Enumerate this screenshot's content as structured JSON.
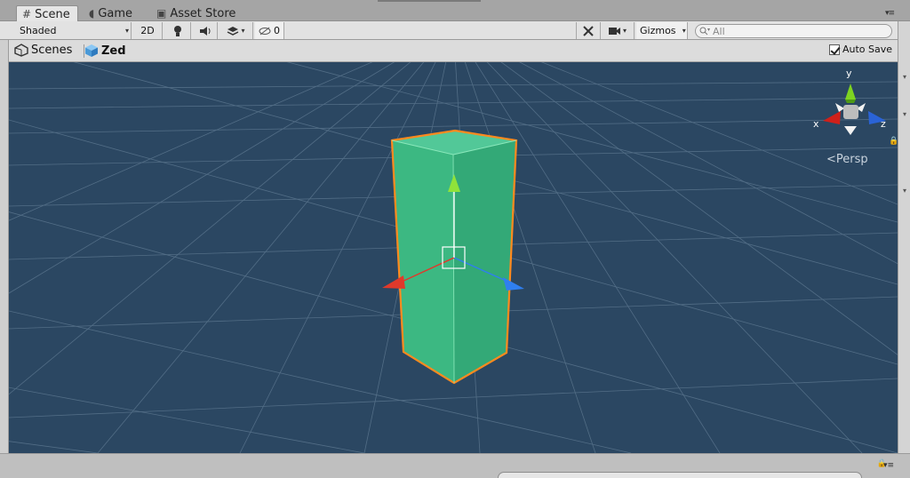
{
  "tabs": [
    {
      "label": "Scene",
      "icon": "grid-icon",
      "active": true
    },
    {
      "label": "Game",
      "icon": "pacman-icon",
      "active": false
    },
    {
      "label": "Asset Store",
      "icon": "bag-icon",
      "active": false
    }
  ],
  "toolbar": {
    "shading_mode": "Shaded",
    "mode_2d_label": "2D",
    "hidden_count": "0",
    "gizmos_label": "Gizmos",
    "search_placeholder": "All"
  },
  "breadcrumb": {
    "scenes_label": "Scenes",
    "prefab_name": "Zed"
  },
  "autosave": {
    "label": "Auto Save",
    "checked": true
  },
  "gizmo": {
    "x_label": "x",
    "y_label": "y",
    "z_label": "z",
    "projection_label": "Persp"
  },
  "colors": {
    "viewport_bg": "#2b4762",
    "cube_fill": "#36b07a",
    "selection_outline": "#ff8a1e",
    "axis_x": "#e0392b",
    "axis_y": "#8fe33a",
    "axis_z": "#2f7ff0"
  }
}
